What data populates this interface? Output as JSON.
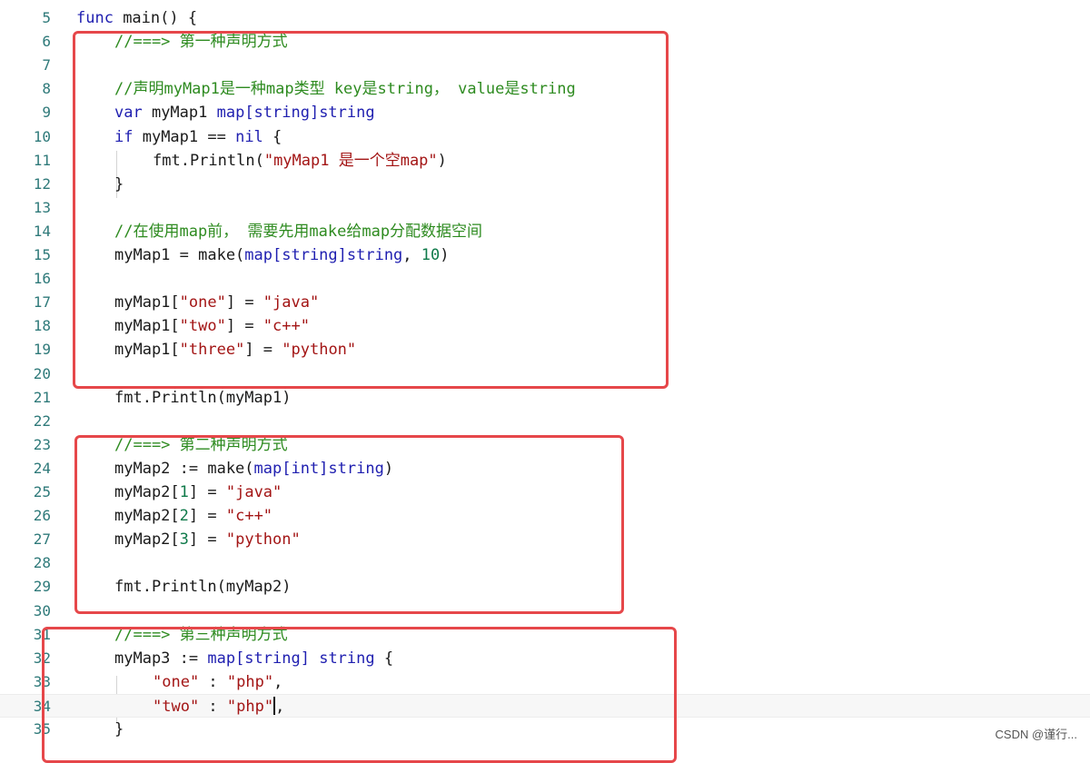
{
  "editor": {
    "lines": [
      {
        "n": "5",
        "tokens": [
          {
            "t": "kw",
            "v": "func"
          },
          {
            "t": "plain",
            "v": " main() {"
          }
        ]
      },
      {
        "n": "6",
        "indent": 1,
        "tokens": [
          {
            "t": "cm",
            "v": "//===> 第一种声明方式"
          }
        ]
      },
      {
        "n": "7",
        "tokens": []
      },
      {
        "n": "8",
        "indent": 1,
        "tokens": [
          {
            "t": "cm",
            "v": "//声明myMap1是一种map类型 key是string， value是string"
          }
        ]
      },
      {
        "n": "9",
        "indent": 1,
        "tokens": [
          {
            "t": "kw",
            "v": "var"
          },
          {
            "t": "plain",
            "v": " myMap1 "
          },
          {
            "t": "kw",
            "v": "map[string]string"
          }
        ]
      },
      {
        "n": "10",
        "indent": 1,
        "tokens": [
          {
            "t": "kw",
            "v": "if"
          },
          {
            "t": "plain",
            "v": " myMap1 == "
          },
          {
            "t": "kw",
            "v": "nil"
          },
          {
            "t": "plain",
            "v": " {"
          }
        ]
      },
      {
        "n": "11",
        "indent": 2,
        "tokens": [
          {
            "t": "plain",
            "v": "fmt.Println("
          },
          {
            "t": "str",
            "v": "\"myMap1 是一个空map\""
          },
          {
            "t": "plain",
            "v": ")"
          }
        ]
      },
      {
        "n": "12",
        "indent": 1,
        "tokens": [
          {
            "t": "plain",
            "v": "}"
          }
        ]
      },
      {
        "n": "13",
        "tokens": []
      },
      {
        "n": "14",
        "indent": 1,
        "tokens": [
          {
            "t": "cm",
            "v": "//在使用map前， 需要先用make给map分配数据空间"
          }
        ]
      },
      {
        "n": "15",
        "indent": 1,
        "tokens": [
          {
            "t": "plain",
            "v": "myMap1 = make("
          },
          {
            "t": "kw",
            "v": "map[string]string"
          },
          {
            "t": "plain",
            "v": ", "
          },
          {
            "t": "num",
            "v": "10"
          },
          {
            "t": "plain",
            "v": ")"
          }
        ]
      },
      {
        "n": "16",
        "tokens": []
      },
      {
        "n": "17",
        "indent": 1,
        "tokens": [
          {
            "t": "plain",
            "v": "myMap1["
          },
          {
            "t": "str",
            "v": "\"one\""
          },
          {
            "t": "plain",
            "v": "] = "
          },
          {
            "t": "str",
            "v": "\"java\""
          }
        ]
      },
      {
        "n": "18",
        "indent": 1,
        "tokens": [
          {
            "t": "plain",
            "v": "myMap1["
          },
          {
            "t": "str",
            "v": "\"two\""
          },
          {
            "t": "plain",
            "v": "] = "
          },
          {
            "t": "str",
            "v": "\"c++\""
          }
        ]
      },
      {
        "n": "19",
        "indent": 1,
        "tokens": [
          {
            "t": "plain",
            "v": "myMap1["
          },
          {
            "t": "str",
            "v": "\"three\""
          },
          {
            "t": "plain",
            "v": "] = "
          },
          {
            "t": "str",
            "v": "\"python\""
          }
        ]
      },
      {
        "n": "20",
        "tokens": []
      },
      {
        "n": "21",
        "indent": 1,
        "tokens": [
          {
            "t": "plain",
            "v": "fmt.Println(myMap1)"
          }
        ]
      },
      {
        "n": "22",
        "tokens": []
      },
      {
        "n": "23",
        "indent": 1,
        "tokens": [
          {
            "t": "cm",
            "v": "//===> 第二种声明方式"
          }
        ]
      },
      {
        "n": "24",
        "indent": 1,
        "tokens": [
          {
            "t": "plain",
            "v": "myMap2 := make("
          },
          {
            "t": "kw",
            "v": "map[int]string"
          },
          {
            "t": "plain",
            "v": ")"
          }
        ]
      },
      {
        "n": "25",
        "indent": 1,
        "tokens": [
          {
            "t": "plain",
            "v": "myMap2["
          },
          {
            "t": "num",
            "v": "1"
          },
          {
            "t": "plain",
            "v": "] = "
          },
          {
            "t": "str",
            "v": "\"java\""
          }
        ]
      },
      {
        "n": "26",
        "indent": 1,
        "tokens": [
          {
            "t": "plain",
            "v": "myMap2["
          },
          {
            "t": "num",
            "v": "2"
          },
          {
            "t": "plain",
            "v": "] = "
          },
          {
            "t": "str",
            "v": "\"c++\""
          }
        ]
      },
      {
        "n": "27",
        "indent": 1,
        "tokens": [
          {
            "t": "plain",
            "v": "myMap2["
          },
          {
            "t": "num",
            "v": "3"
          },
          {
            "t": "plain",
            "v": "] = "
          },
          {
            "t": "str",
            "v": "\"python\""
          }
        ]
      },
      {
        "n": "28",
        "tokens": []
      },
      {
        "n": "29",
        "indent": 1,
        "tokens": [
          {
            "t": "plain",
            "v": "fmt.Println(myMap2)"
          }
        ]
      },
      {
        "n": "30",
        "tokens": []
      },
      {
        "n": "31",
        "indent": 1,
        "tokens": [
          {
            "t": "cm",
            "v": "//===> 第三种声明方式"
          }
        ]
      },
      {
        "n": "32",
        "indent": 1,
        "tokens": [
          {
            "t": "plain",
            "v": "myMap3 := "
          },
          {
            "t": "kw",
            "v": "map[string]"
          },
          {
            "t": "plain",
            "v": " "
          },
          {
            "t": "kw",
            "v": "string"
          },
          {
            "t": "plain",
            "v": " {"
          }
        ]
      },
      {
        "n": "33",
        "indent": 2,
        "tokens": [
          {
            "t": "str",
            "v": "\"one\""
          },
          {
            "t": "plain",
            "v": " : "
          },
          {
            "t": "str",
            "v": "\"php\""
          },
          {
            "t": "plain",
            "v": ","
          }
        ]
      },
      {
        "n": "34",
        "indent": 2,
        "cursor": true,
        "tokens": [
          {
            "t": "str",
            "v": "\"two\""
          },
          {
            "t": "plain",
            "v": " : "
          },
          {
            "t": "str",
            "v": "\"php\""
          },
          {
            "t": "caret",
            "v": ""
          },
          {
            "t": "plain",
            "v": ","
          }
        ]
      },
      {
        "n": "35",
        "indent": 1,
        "tokens": [
          {
            "t": "plain",
            "v": "}"
          }
        ]
      }
    ]
  },
  "highlight_color": "#e6474a",
  "watermark": "CSDN @谨行..."
}
